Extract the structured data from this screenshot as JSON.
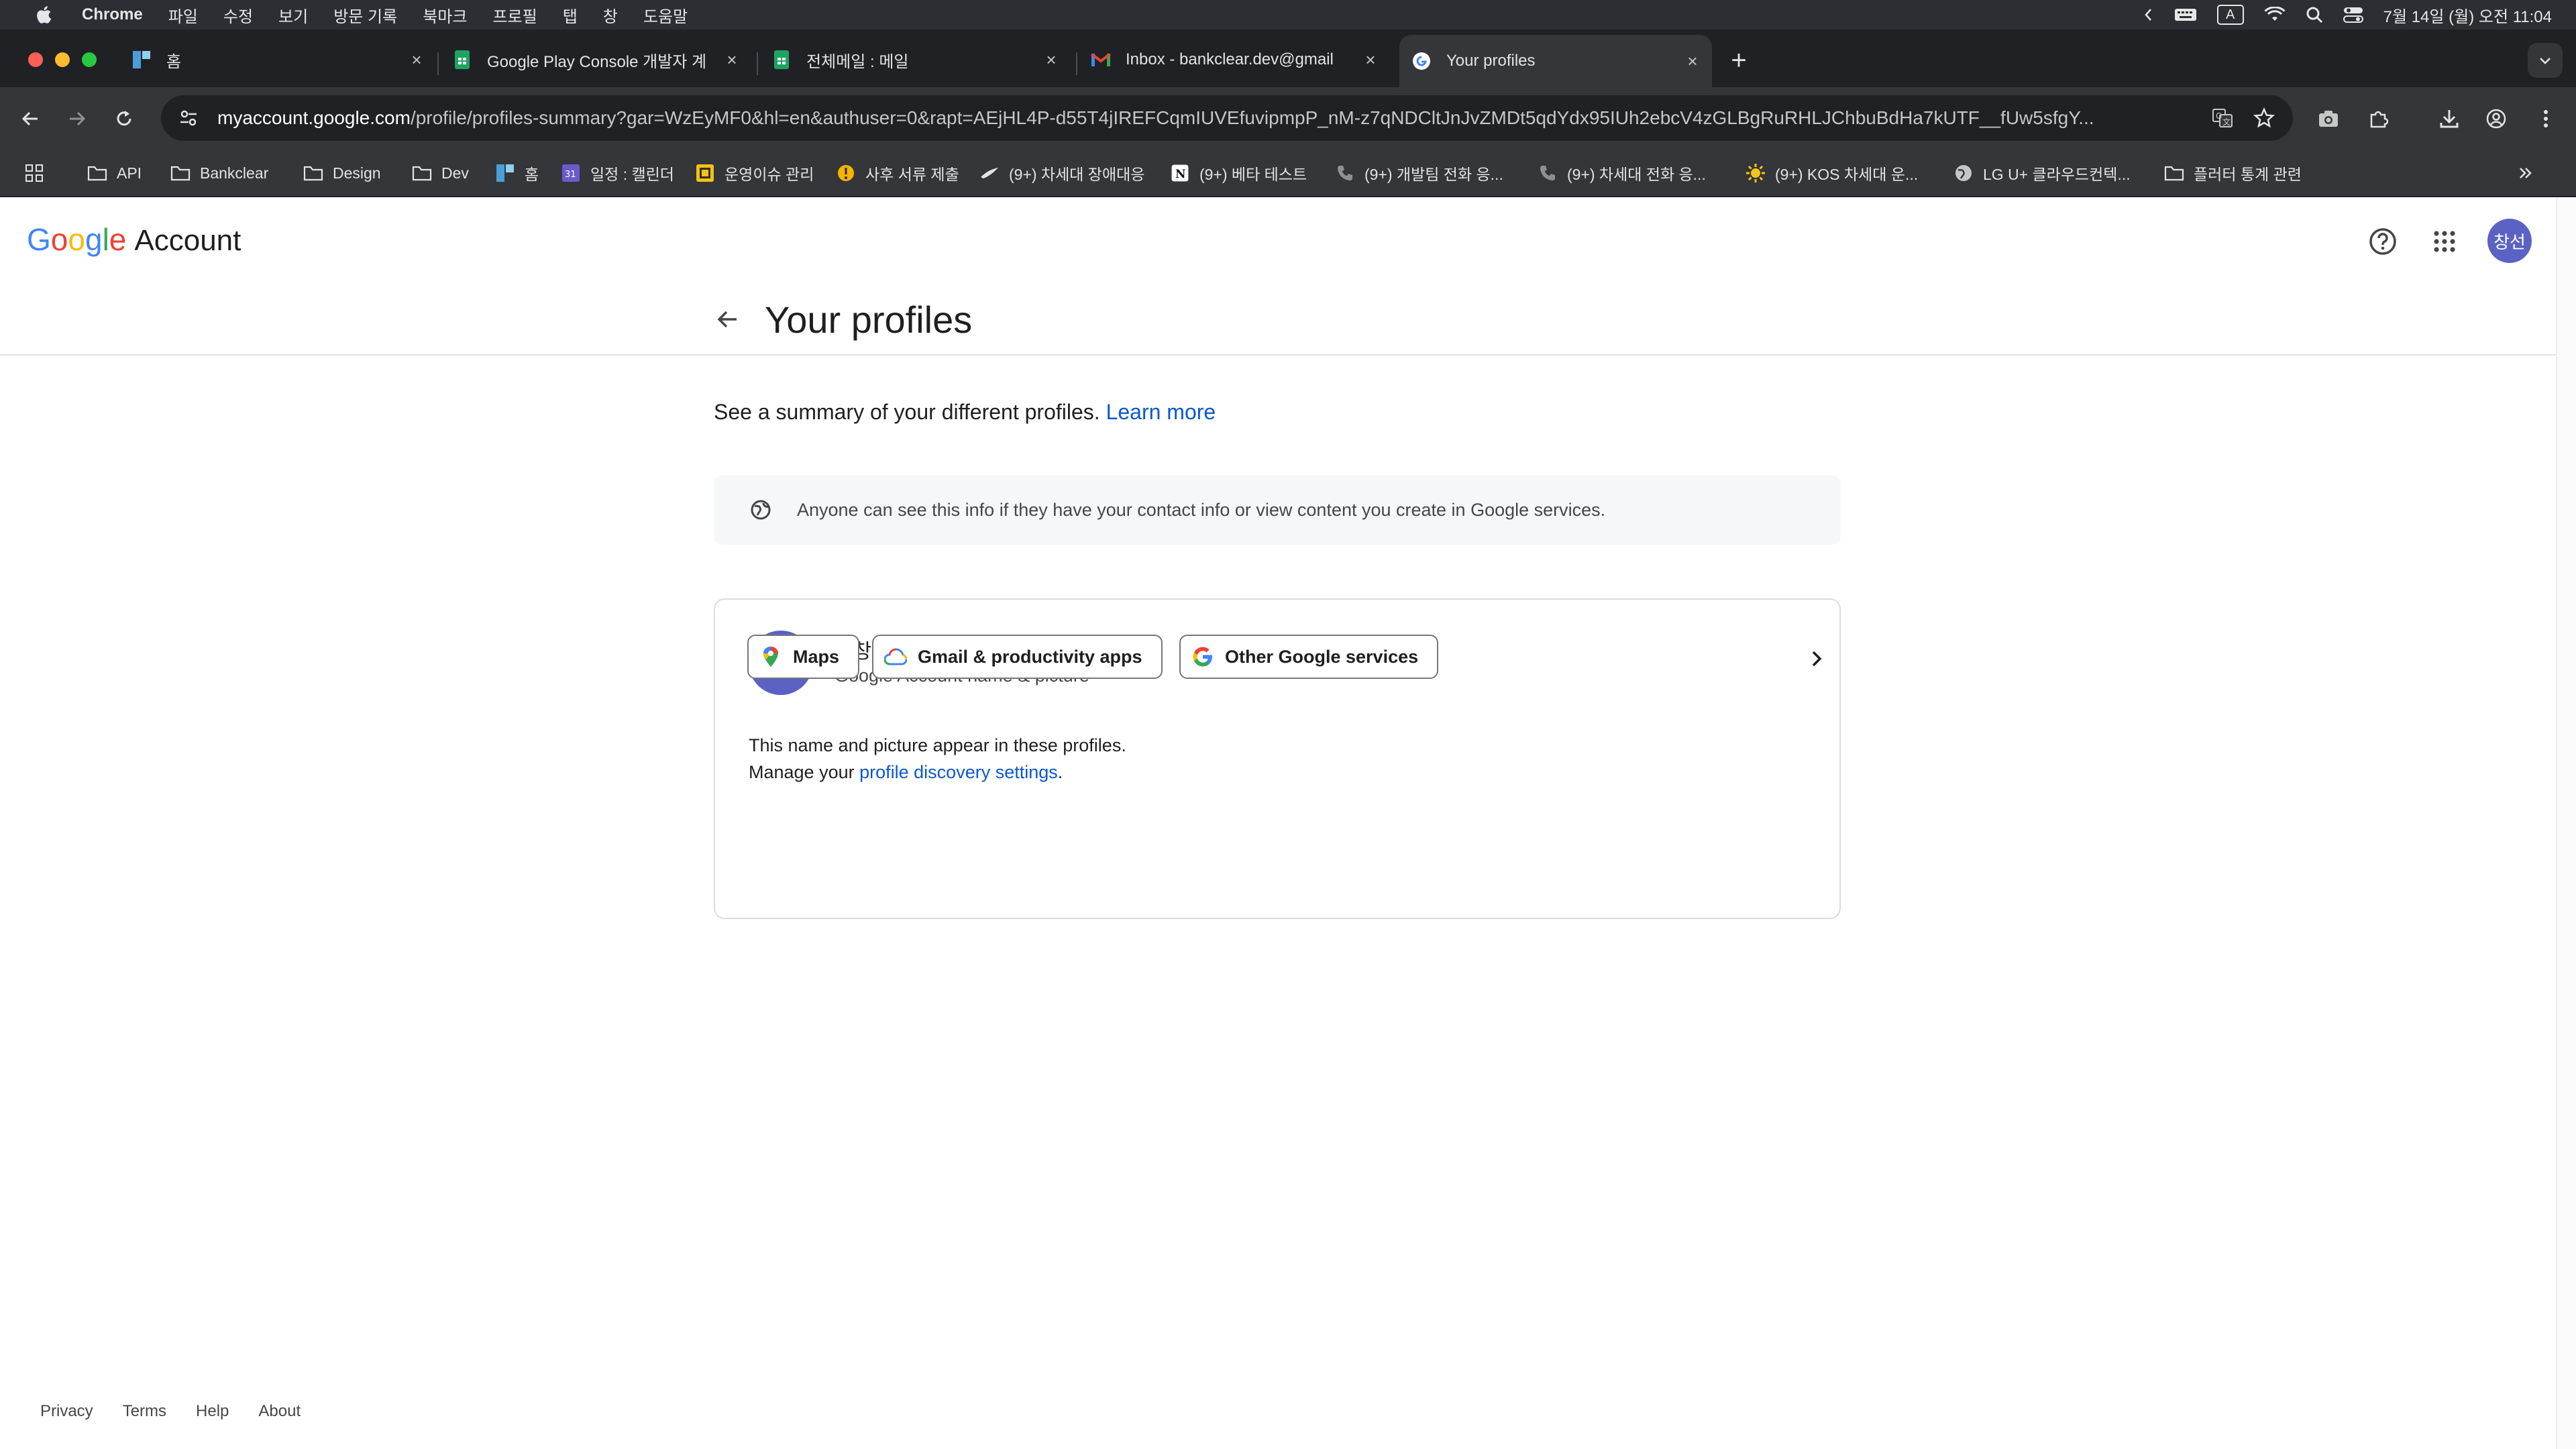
{
  "menubar": {
    "app_name": "Chrome",
    "items": [
      "파일",
      "수정",
      "보기",
      "방문 기록",
      "북마크",
      "프로필",
      "탭",
      "창",
      "도움말"
    ],
    "keyboard_input": "A",
    "datetime": "7월 14일 (월) 오전 11:04"
  },
  "tabs": [
    {
      "title": "홈",
      "icon": "confluence-icon",
      "active": false
    },
    {
      "title": "Google Play Console 개발자 계",
      "icon": "sheets-icon",
      "active": false
    },
    {
      "title": "전체메일 : 메일",
      "icon": "sheets-icon",
      "active": false
    },
    {
      "title": "Inbox - bankclear.dev@gmail",
      "icon": "gmail-icon",
      "active": false
    },
    {
      "title": "Your profiles",
      "icon": "google-icon",
      "active": true
    }
  ],
  "omnibox": {
    "url_host": "myaccount.google.com",
    "url_path": "/profile/profiles-summary?gar=WzEyMF0&hl=en&authuser=0&rapt=AEjHL4P-d55T4jIREFCqmIUVEfuvipmpP_nM-z7qNDCltJnJvZMDt5qdYdx95IUh2ebcV4zGLBgRuRHLJChbuBdHa7kUTF__fUw5sfgY..."
  },
  "bookmarks": [
    {
      "label": "API",
      "icon": "folder-icon"
    },
    {
      "label": "Bankclear",
      "icon": "folder-icon"
    },
    {
      "label": "Design",
      "icon": "folder-icon"
    },
    {
      "label": "Dev",
      "icon": "folder-icon"
    },
    {
      "label": "홈",
      "icon": "confluence-icon"
    },
    {
      "label": "일정 : 캘린더",
      "icon": "calendar-icon"
    },
    {
      "label": "운영이슈 관리",
      "icon": "tracker-icon"
    },
    {
      "label": "사후 서류 제출",
      "icon": "warning-icon"
    },
    {
      "label": "(9+) 차세대 장애대응",
      "icon": "bird-icon"
    },
    {
      "label": "(9+) 베타 테스트",
      "icon": "notion-icon"
    },
    {
      "label": "(9+) 개발팀 전화 응...",
      "icon": "phone-icon"
    },
    {
      "label": "(9+) 차세대 전화 응...",
      "icon": "phone-icon"
    },
    {
      "label": "(9+) KOS 차세대 운...",
      "icon": "sun-icon"
    },
    {
      "label": "LG U+ 클라우드컨텍...",
      "icon": "globe-icon"
    },
    {
      "label": "플러터 통계 관련",
      "icon": "folder-icon"
    }
  ],
  "header": {
    "logo_letters": [
      "G",
      "o",
      "o",
      "g",
      "l",
      "e"
    ],
    "logo_colors": [
      "#4285f4",
      "#ea4335",
      "#fbbc05",
      "#4285f4",
      "#34a853",
      "#ea4335"
    ],
    "account_word": "Account",
    "avatar_initials": "창선"
  },
  "page": {
    "title": "Your profiles",
    "summary_text": "See a summary of your different profiles.",
    "learn_more": "Learn more",
    "notice": "Anyone can see this info if they have your contact info or view content you create in Google services."
  },
  "profile_card": {
    "avatar_initials": "창선",
    "name": "류창선",
    "subtitle": "Google Account name & picture",
    "desc_line1": "This name and picture appear in these profiles.",
    "desc_line2_prefix": "Manage your",
    "desc_line2_link": "profile discovery settings",
    "desc_line2_suffix": ".",
    "chips": [
      {
        "label": "Maps",
        "icon": "maps-pin-icon"
      },
      {
        "label": "Gmail & productivity apps",
        "icon": "google-cloud-icon"
      },
      {
        "label": "Other Google services",
        "icon": "google-g-icon"
      }
    ]
  },
  "footer": {
    "links": [
      "Privacy",
      "Terms",
      "Help",
      "About"
    ]
  },
  "colors": {
    "link": "#0b57d0",
    "avatar": "#5b62c4",
    "chrome_dark": "#202124",
    "chrome_toolbar": "#35363a"
  }
}
